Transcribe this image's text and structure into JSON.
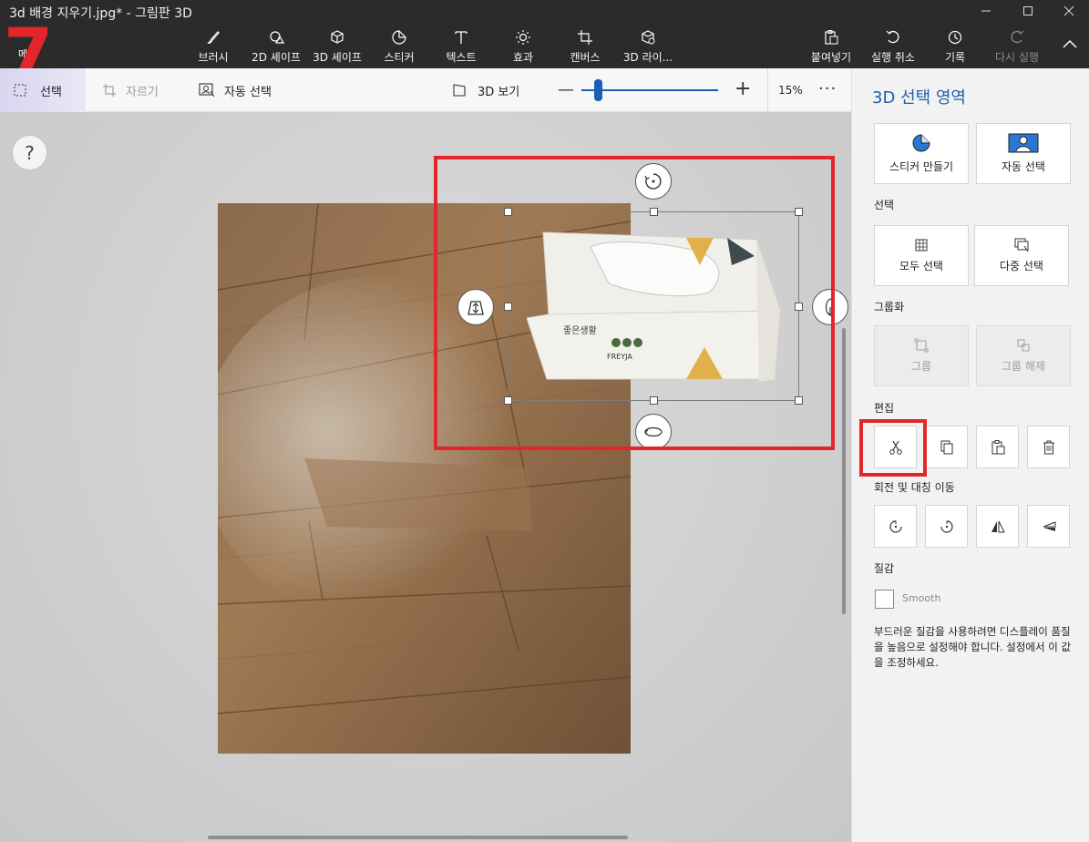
{
  "window": {
    "title": "3d 배경 지우기.jpg* - 그림판 3D"
  },
  "annotation": {
    "step_number": "7"
  },
  "menu": {
    "label": "메뉴"
  },
  "ribbon": {
    "tools": [
      {
        "label": "브러시",
        "icon": "brush-icon"
      },
      {
        "label": "2D 셰이프",
        "icon": "shapes-2d-icon"
      },
      {
        "label": "3D 셰이프",
        "icon": "cube-icon"
      },
      {
        "label": "스티커",
        "icon": "sticker-icon"
      },
      {
        "label": "텍스트",
        "icon": "text-icon"
      },
      {
        "label": "효과",
        "icon": "effects-icon"
      },
      {
        "label": "캔버스",
        "icon": "canvas-icon"
      },
      {
        "label": "3D 라이...",
        "icon": "library-3d-icon"
      }
    ],
    "actions": [
      {
        "label": "붙여넣기",
        "icon": "paste-icon"
      },
      {
        "label": "실행 취소",
        "icon": "undo-icon"
      },
      {
        "label": "기록",
        "icon": "history-icon"
      },
      {
        "label": "다시 실행",
        "icon": "redo-icon",
        "disabled": true
      }
    ]
  },
  "subbar": {
    "select_label": "선택",
    "crop_label": "자르기",
    "auto_select_label": "자동 선택",
    "view3d_label": "3D 보기",
    "zoom_value": "15%",
    "zoom_level_fraction": 0.12,
    "more": "···"
  },
  "canvas": {
    "help_label": "?"
  },
  "panel": {
    "title": "3D 선택 영역",
    "top_cards": [
      {
        "label": "스티커 만들기",
        "icon": "make-sticker-icon"
      },
      {
        "label": "자동 선택",
        "icon": "auto-select-icon"
      }
    ],
    "select_section": "선택",
    "select_cards": [
      {
        "label": "모두 선택",
        "icon": "select-all-icon"
      },
      {
        "label": "다중 선택",
        "icon": "multi-select-icon"
      }
    ],
    "group_section": "그룹화",
    "group_cards": [
      {
        "label": "그룹",
        "icon": "group-icon"
      },
      {
        "label": "그룹 해제",
        "icon": "ungroup-icon"
      }
    ],
    "edit_section": "편집",
    "edit_buttons": [
      "cut-icon",
      "copy-icon",
      "paste-icon",
      "delete-icon"
    ],
    "rotate_section": "회전 및 대칭 이동",
    "rotate_buttons": [
      "rotate-left-icon",
      "rotate-right-icon",
      "flip-horizontal-icon",
      "flip-vertical-icon"
    ],
    "texture_section": "질감",
    "smooth_label": "Smooth",
    "smooth_checked": false,
    "note": "부드러운 질감을 사용하려면 디스플레이 품질을 높음으로 설정해야 합니다. 설정에서 이 값을 조정하세요."
  },
  "colors": {
    "accent": "#1f5fb0",
    "highlight_red": "#e3262b",
    "ribbon_bg": "#2b2b2b"
  }
}
